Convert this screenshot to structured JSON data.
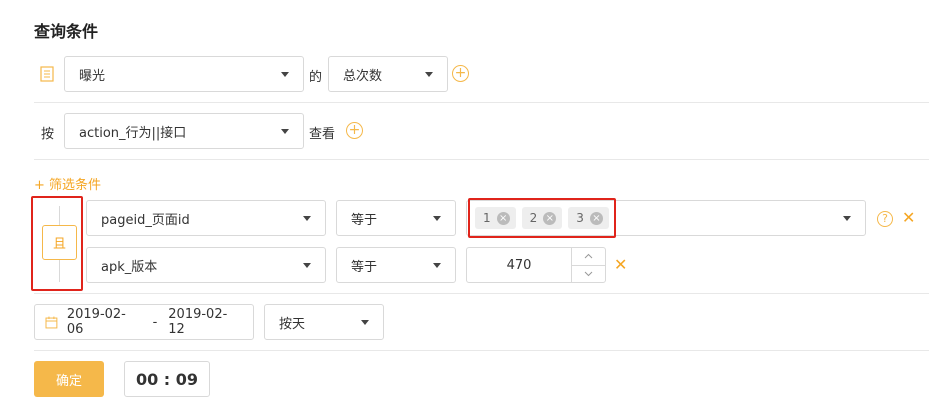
{
  "title": "查询条件",
  "event_select": {
    "value": "曝光"
  },
  "of_text": "的",
  "metric_select": {
    "value": "总次数"
  },
  "by_text": "按",
  "group_select": {
    "value": "action_行为||接口"
  },
  "view_text": "查看",
  "add_filter": "+ 筛选条件",
  "logic_op": "且",
  "filters": [
    {
      "field": "pageid_页面id",
      "operator": "等于",
      "values": [
        "1",
        "2",
        "3"
      ]
    },
    {
      "field": "apk_版本",
      "operator": "等于",
      "value": "470"
    }
  ],
  "date_range": {
    "start": "2019-02-06",
    "separator": "-",
    "end": "2019-02-12"
  },
  "granularity": {
    "value": "按天"
  },
  "confirm_button": "确定",
  "timer": "00 : 09",
  "colors": {
    "accent": "#f5b84a",
    "highlight_box": "#e0241b"
  },
  "icons": [
    "document-icon",
    "plus-circle-icon",
    "calendar-icon",
    "question-icon",
    "close-icon",
    "tag-remove-icon",
    "stepper-up-icon",
    "stepper-down-icon",
    "chevron-down-icon"
  ]
}
